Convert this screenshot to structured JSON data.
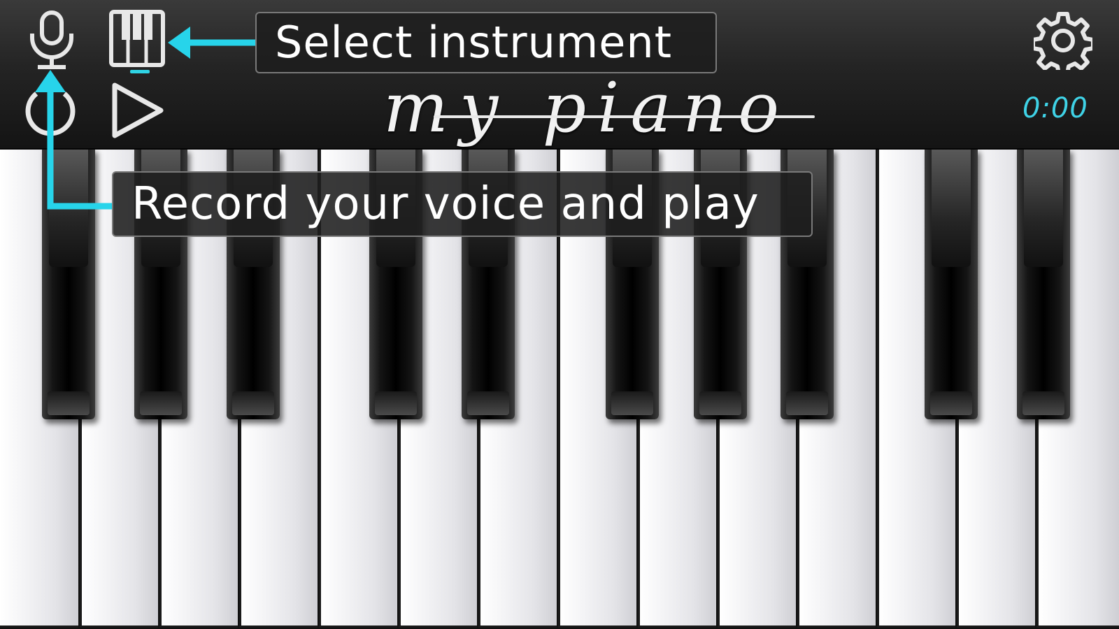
{
  "app": {
    "logo_text": "my piano",
    "timer": "0:00"
  },
  "toolbar": {
    "buttons": [
      {
        "name": "microphone",
        "icon": "microphone-icon"
      },
      {
        "name": "instrument",
        "icon": "piano-keys-icon"
      },
      {
        "name": "record",
        "icon": "record-power-icon"
      },
      {
        "name": "play",
        "icon": "play-icon"
      },
      {
        "name": "settings",
        "icon": "gear-icon"
      }
    ]
  },
  "tutorial": {
    "select_instrument": "Select instrument",
    "record_voice": "Record your voice and play"
  },
  "colors": {
    "accent": "#2fd3e4",
    "toolbar_bg": "#242424",
    "timer": "#3fd2e6"
  }
}
